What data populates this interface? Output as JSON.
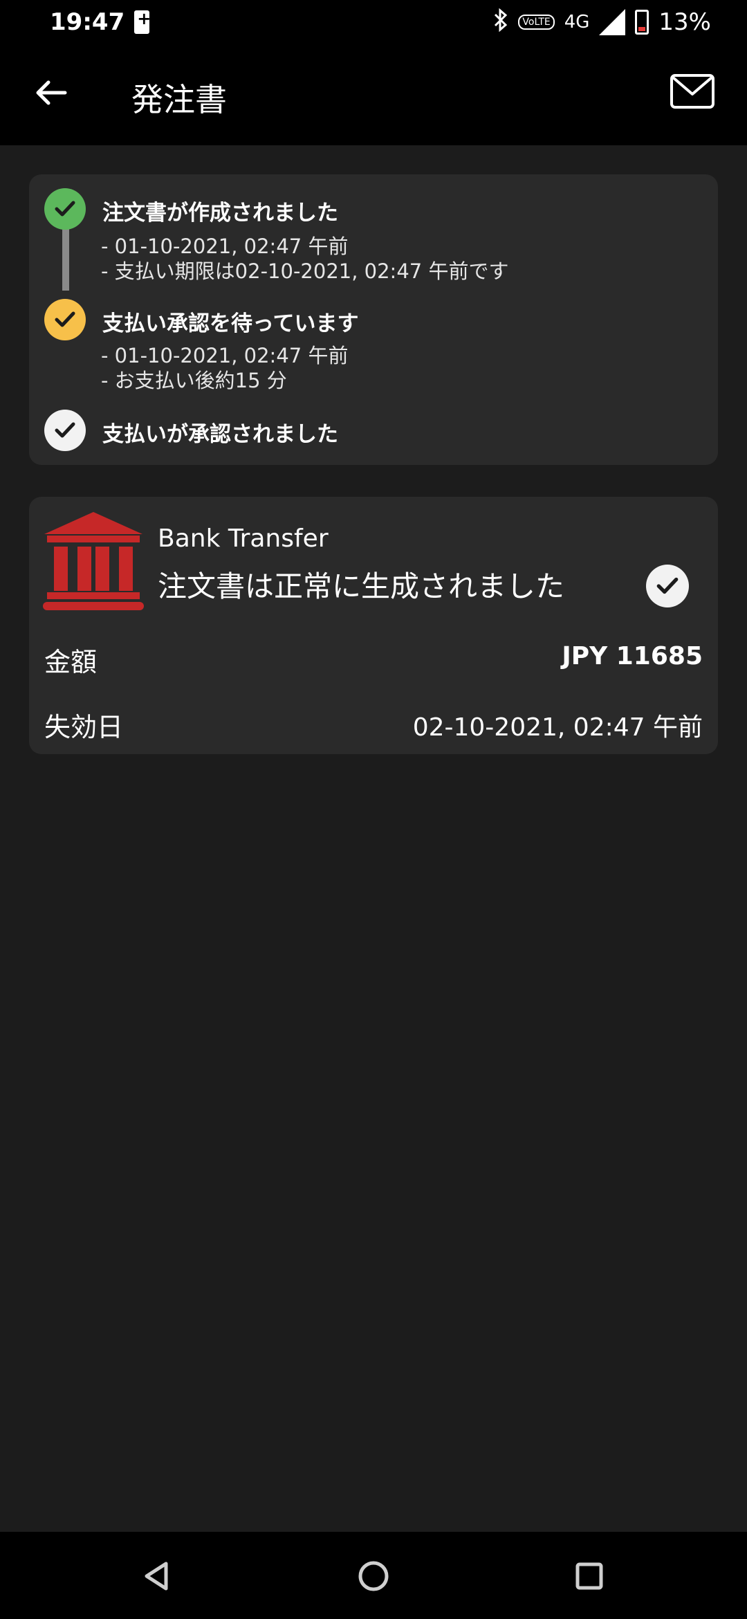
{
  "status_bar": {
    "time": "19:47",
    "network": "4G",
    "battery_pct": "13%",
    "icons": [
      "battery-charging-icon",
      "bluetooth-icon",
      "volte-icon",
      "signal-icon",
      "battery-icon"
    ]
  },
  "app_bar": {
    "title": "発注書",
    "back_icon": "arrow-left-icon",
    "mail_icon": "envelope-icon"
  },
  "timeline": {
    "steps": [
      {
        "title": "注文書が作成されました",
        "lines": [
          "- 01-10-2021, 02:47 午前",
          "- 支払い期限は02-10-2021, 02:47 午前です"
        ],
        "state": "done",
        "color": "#5cb85c"
      },
      {
        "title": "支払い承認を待っています",
        "lines": [
          "- 01-10-2021, 02:47 午前",
          "- お支払い後約15 分"
        ],
        "state": "pending",
        "color": "#f7c04a"
      },
      {
        "title": "支払いが承認されました",
        "lines": [],
        "state": "inactive",
        "color": "#f2f2f2"
      }
    ],
    "connector_color": "#8a8a8a"
  },
  "payment": {
    "method_icon": "bank-icon",
    "method_color": "#c62828",
    "method_name": "Bank Transfer",
    "status_text": "注文書は正常に生成されました",
    "amount_label": "金額",
    "amount_value": "JPY 11685",
    "expiry_label": "失効日",
    "expiry_value": "02-10-2021, 02:47 午前"
  },
  "nav_bar": {
    "buttons": [
      "back-triangle-icon",
      "home-circle-icon",
      "recents-square-icon"
    ]
  }
}
